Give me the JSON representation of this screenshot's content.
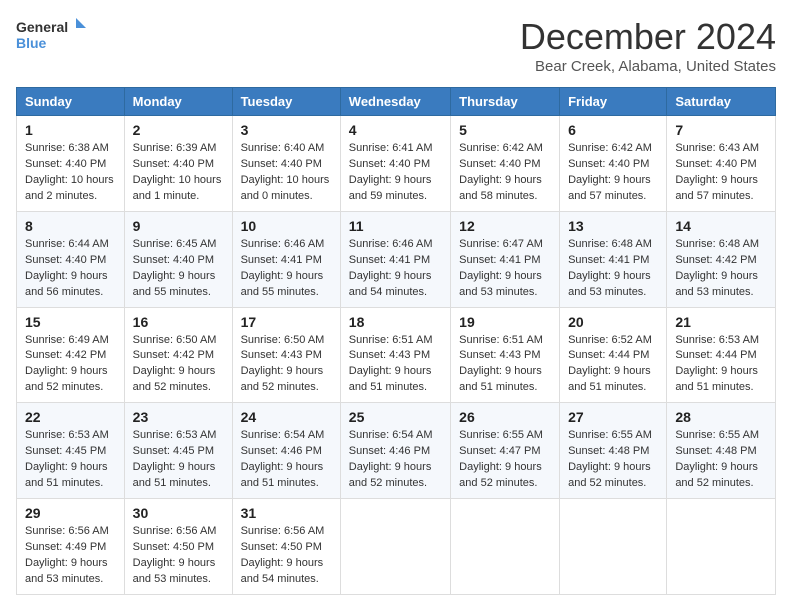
{
  "header": {
    "logo_general": "General",
    "logo_blue": "Blue",
    "month_year": "December 2024",
    "location": "Bear Creek, Alabama, United States"
  },
  "days_of_week": [
    "Sunday",
    "Monday",
    "Tuesday",
    "Wednesday",
    "Thursday",
    "Friday",
    "Saturday"
  ],
  "weeks": [
    [
      {
        "day": "1",
        "sunrise": "6:38 AM",
        "sunset": "4:40 PM",
        "daylight": "10 hours and 2 minutes."
      },
      {
        "day": "2",
        "sunrise": "6:39 AM",
        "sunset": "4:40 PM",
        "daylight": "10 hours and 1 minute."
      },
      {
        "day": "3",
        "sunrise": "6:40 AM",
        "sunset": "4:40 PM",
        "daylight": "10 hours and 0 minutes."
      },
      {
        "day": "4",
        "sunrise": "6:41 AM",
        "sunset": "4:40 PM",
        "daylight": "9 hours and 59 minutes."
      },
      {
        "day": "5",
        "sunrise": "6:42 AM",
        "sunset": "4:40 PM",
        "daylight": "9 hours and 58 minutes."
      },
      {
        "day": "6",
        "sunrise": "6:42 AM",
        "sunset": "4:40 PM",
        "daylight": "9 hours and 57 minutes."
      },
      {
        "day": "7",
        "sunrise": "6:43 AM",
        "sunset": "4:40 PM",
        "daylight": "9 hours and 57 minutes."
      }
    ],
    [
      {
        "day": "8",
        "sunrise": "6:44 AM",
        "sunset": "4:40 PM",
        "daylight": "9 hours and 56 minutes."
      },
      {
        "day": "9",
        "sunrise": "6:45 AM",
        "sunset": "4:40 PM",
        "daylight": "9 hours and 55 minutes."
      },
      {
        "day": "10",
        "sunrise": "6:46 AM",
        "sunset": "4:41 PM",
        "daylight": "9 hours and 55 minutes."
      },
      {
        "day": "11",
        "sunrise": "6:46 AM",
        "sunset": "4:41 PM",
        "daylight": "9 hours and 54 minutes."
      },
      {
        "day": "12",
        "sunrise": "6:47 AM",
        "sunset": "4:41 PM",
        "daylight": "9 hours and 53 minutes."
      },
      {
        "day": "13",
        "sunrise": "6:48 AM",
        "sunset": "4:41 PM",
        "daylight": "9 hours and 53 minutes."
      },
      {
        "day": "14",
        "sunrise": "6:48 AM",
        "sunset": "4:42 PM",
        "daylight": "9 hours and 53 minutes."
      }
    ],
    [
      {
        "day": "15",
        "sunrise": "6:49 AM",
        "sunset": "4:42 PM",
        "daylight": "9 hours and 52 minutes."
      },
      {
        "day": "16",
        "sunrise": "6:50 AM",
        "sunset": "4:42 PM",
        "daylight": "9 hours and 52 minutes."
      },
      {
        "day": "17",
        "sunrise": "6:50 AM",
        "sunset": "4:43 PM",
        "daylight": "9 hours and 52 minutes."
      },
      {
        "day": "18",
        "sunrise": "6:51 AM",
        "sunset": "4:43 PM",
        "daylight": "9 hours and 51 minutes."
      },
      {
        "day": "19",
        "sunrise": "6:51 AM",
        "sunset": "4:43 PM",
        "daylight": "9 hours and 51 minutes."
      },
      {
        "day": "20",
        "sunrise": "6:52 AM",
        "sunset": "4:44 PM",
        "daylight": "9 hours and 51 minutes."
      },
      {
        "day": "21",
        "sunrise": "6:53 AM",
        "sunset": "4:44 PM",
        "daylight": "9 hours and 51 minutes."
      }
    ],
    [
      {
        "day": "22",
        "sunrise": "6:53 AM",
        "sunset": "4:45 PM",
        "daylight": "9 hours and 51 minutes."
      },
      {
        "day": "23",
        "sunrise": "6:53 AM",
        "sunset": "4:45 PM",
        "daylight": "9 hours and 51 minutes."
      },
      {
        "day": "24",
        "sunrise": "6:54 AM",
        "sunset": "4:46 PM",
        "daylight": "9 hours and 51 minutes."
      },
      {
        "day": "25",
        "sunrise": "6:54 AM",
        "sunset": "4:46 PM",
        "daylight": "9 hours and 52 minutes."
      },
      {
        "day": "26",
        "sunrise": "6:55 AM",
        "sunset": "4:47 PM",
        "daylight": "9 hours and 52 minutes."
      },
      {
        "day": "27",
        "sunrise": "6:55 AM",
        "sunset": "4:48 PM",
        "daylight": "9 hours and 52 minutes."
      },
      {
        "day": "28",
        "sunrise": "6:55 AM",
        "sunset": "4:48 PM",
        "daylight": "9 hours and 52 minutes."
      }
    ],
    [
      {
        "day": "29",
        "sunrise": "6:56 AM",
        "sunset": "4:49 PM",
        "daylight": "9 hours and 53 minutes."
      },
      {
        "day": "30",
        "sunrise": "6:56 AM",
        "sunset": "4:50 PM",
        "daylight": "9 hours and 53 minutes."
      },
      {
        "day": "31",
        "sunrise": "6:56 AM",
        "sunset": "4:50 PM",
        "daylight": "9 hours and 54 minutes."
      },
      null,
      null,
      null,
      null
    ]
  ],
  "labels": {
    "sunrise": "Sunrise:",
    "sunset": "Sunset:",
    "daylight": "Daylight:"
  }
}
